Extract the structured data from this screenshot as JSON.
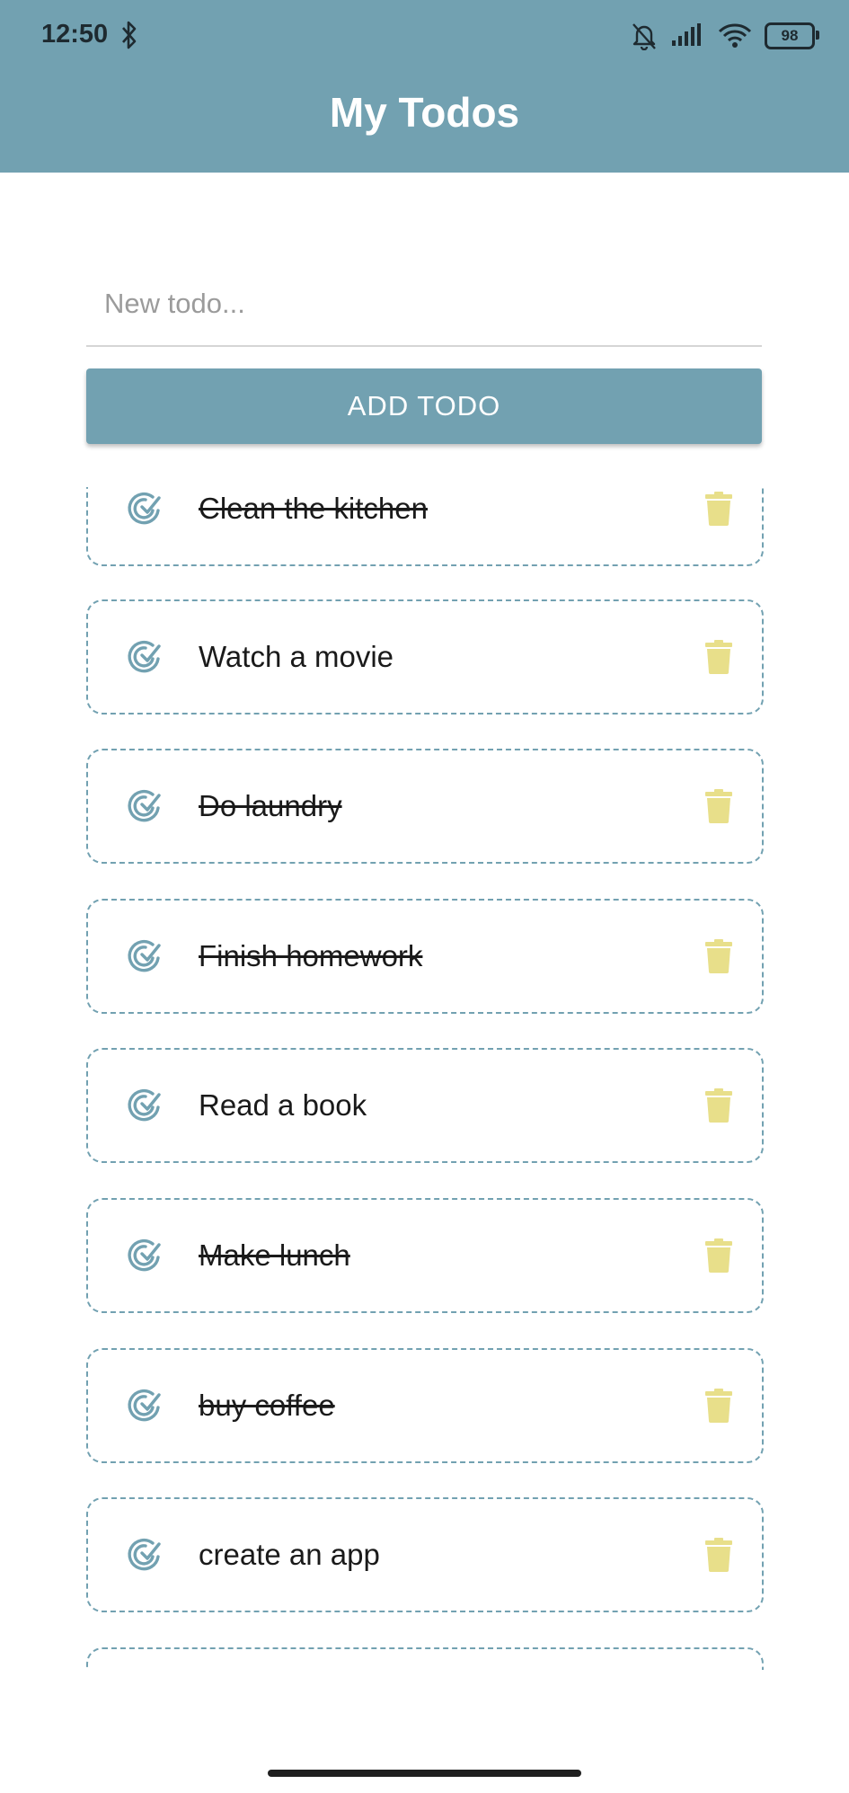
{
  "status_bar": {
    "time": "12:50",
    "battery": "98"
  },
  "header": {
    "title": "My Todos"
  },
  "new_todo": {
    "placeholder": "New todo...",
    "value": ""
  },
  "add_button": {
    "label": "ADD TODO"
  },
  "colors": {
    "primary": "#72a1b1",
    "trash": "#e8df8a"
  },
  "todos": [
    {
      "text": "Clean the kitchen",
      "done": true
    },
    {
      "text": "Watch a movie",
      "done": false
    },
    {
      "text": "Do laundry",
      "done": true
    },
    {
      "text": "Finish homework",
      "done": true
    },
    {
      "text": "Read a book",
      "done": false
    },
    {
      "text": "Make lunch",
      "done": true
    },
    {
      "text": "buy coffee",
      "done": true
    },
    {
      "text": "create an app",
      "done": false
    },
    {
      "text": "",
      "done": false
    }
  ]
}
